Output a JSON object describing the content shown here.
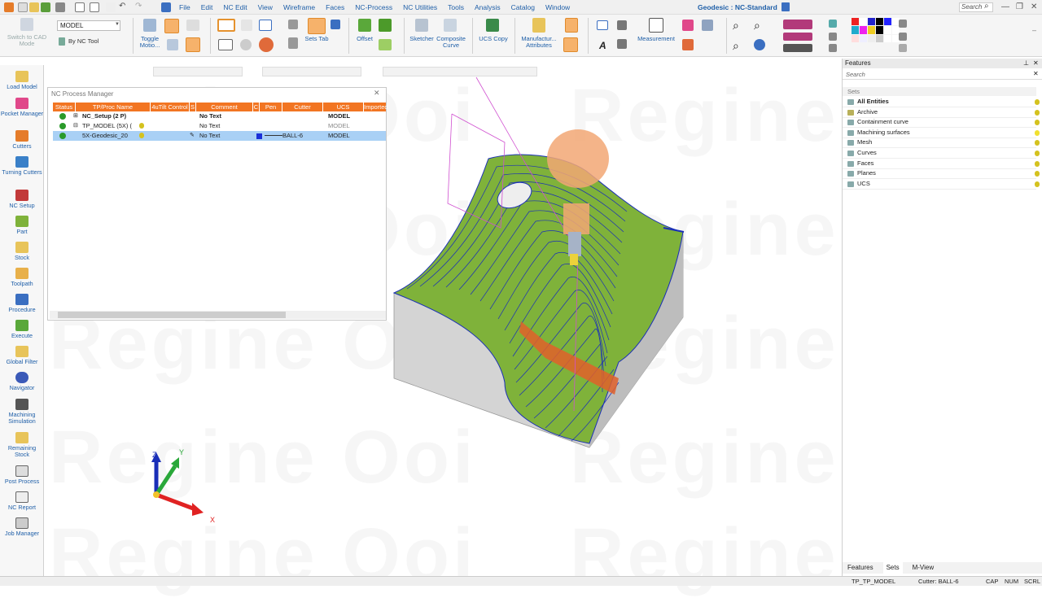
{
  "app": {
    "title": "Geodesic : NC-Standard",
    "menus": [
      "File",
      "Edit",
      "NC Edit",
      "View",
      "Wireframe",
      "Faces",
      "NC-Process",
      "NC Utilities",
      "Tools",
      "Analysis",
      "Catalog",
      "Window"
    ],
    "search_placeholder": "Search",
    "watermark": "Regine Ooi"
  },
  "ribbon": {
    "switch_cad": "Switch to CAD Mode",
    "model_select": "MODEL",
    "by_nc_tool": "By NC Tool",
    "toggle_motion": "Toggle Motio...",
    "sets_tab": "Sets Tab",
    "offset": "Offset",
    "sketcher": "Sketcher",
    "composite_curve": "Composite Curve",
    "ucs_copy": "UCS Copy",
    "manufacturing_attributes": "Manufactur... Attributes",
    "measurement": "Measurement"
  },
  "left_toolbar": [
    "Load Model",
    "Pocket Manager",
    "Cutters",
    "Turning Cutters",
    "NC Setup",
    "Part",
    "Stock",
    "Toolpath",
    "Procedure",
    "Execute",
    "Global Filter",
    "Navigator",
    "Machining Simulation",
    "Remaining Stock",
    "Post Process",
    "NC Report",
    "Job Manager"
  ],
  "nc_process_manager": {
    "title": "NC Process Manager",
    "columns": [
      "Status",
      "TP/Proc Name",
      "4uTilt Control",
      "S",
      "Comment",
      "C",
      "Pen",
      "Cutter",
      "UCS",
      "Imported"
    ],
    "rows": [
      {
        "name": "NC_Setup (2 P)",
        "comment": "No Text",
        "cutter": "",
        "ucs": "MODEL"
      },
      {
        "name": "TP_MODEL (5X) (",
        "comment": "No Text",
        "cutter": "",
        "ucs": "MODEL"
      },
      {
        "name": "5X-Geodesic_20",
        "comment": "No Text",
        "cutter": "BALL-6",
        "ucs": "MODEL"
      }
    ]
  },
  "features_panel": {
    "title": "Features",
    "search_placeholder": "Search",
    "sets_header": "Sets",
    "items": [
      "All Entities",
      "Archive",
      "Containment curve",
      "Machining surfaces",
      "Mesh",
      "Curves",
      "Faces",
      "Planes",
      "UCS"
    ],
    "tabs": [
      "Features",
      "Sets",
      "M-View"
    ]
  },
  "axis": {
    "z": "Z",
    "y": "Y",
    "x": "X"
  },
  "statusbar": {
    "tp": "TP_TP_MODEL",
    "cutter": "Cutter: BALL-6",
    "cap": "CAP",
    "num": "NUM",
    "scrl": "SCRL"
  },
  "colors": {
    "accent": "#f27522",
    "link": "#1f5fa8",
    "surface": "#7fb23a",
    "toolpath": "#1a2fb8",
    "selected_row": "#a9d0f5"
  }
}
